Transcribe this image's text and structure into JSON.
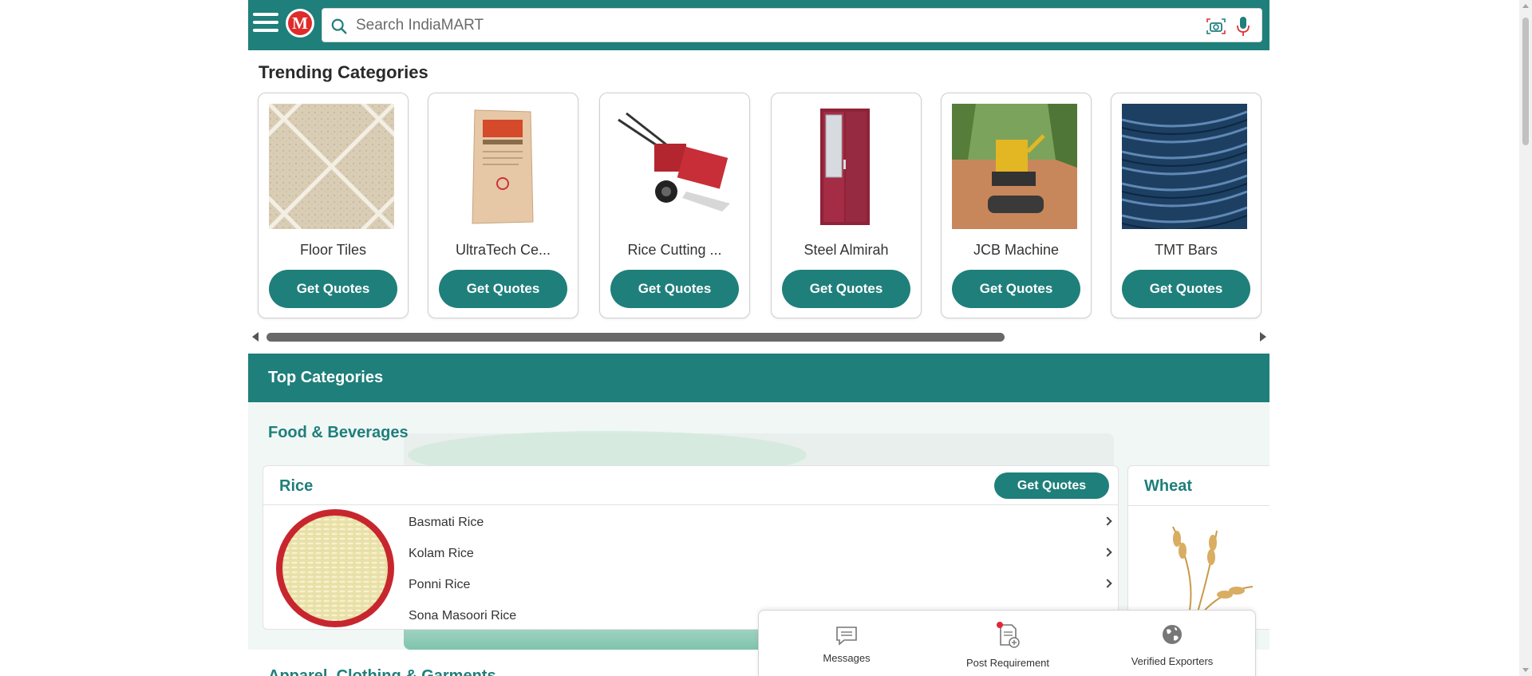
{
  "header": {
    "menu_icon": "hamburger-menu-icon",
    "logo_letter": "M",
    "search": {
      "placeholder": "Search IndiaMART",
      "value": ""
    },
    "camera_icon": "camera-search-icon",
    "mic_icon": "microphone-icon"
  },
  "trending": {
    "title": "Trending Categories",
    "items": [
      {
        "name": "Floor Tiles",
        "button": "Get Quotes"
      },
      {
        "name": "UltraTech Ce...",
        "button": "Get Quotes"
      },
      {
        "name": "Rice Cutting ...",
        "button": "Get Quotes"
      },
      {
        "name": "Steel Almirah",
        "button": "Get Quotes"
      },
      {
        "name": "JCB Machine",
        "button": "Get Quotes"
      },
      {
        "name": "TMT Bars",
        "button": "Get Quotes"
      }
    ]
  },
  "top_categories": {
    "title": "Top Categories",
    "group_title": "Food & Beverages",
    "rice": {
      "title": "Rice",
      "button": "Get Quotes",
      "items": [
        "Basmati Rice",
        "Kolam Rice",
        "Ponni Rice",
        "Sona Masoori Rice"
      ]
    },
    "wheat": {
      "title": "Wheat"
    },
    "next_group_title": "Apparel, Clothing & Garments"
  },
  "bottom_bar": {
    "messages": "Messages",
    "post_requirement": "Post Requirement",
    "verified_exporters": "Verified Exporters"
  },
  "colors": {
    "brand": "#1f7f7b",
    "logo_red": "#e02b2b"
  }
}
